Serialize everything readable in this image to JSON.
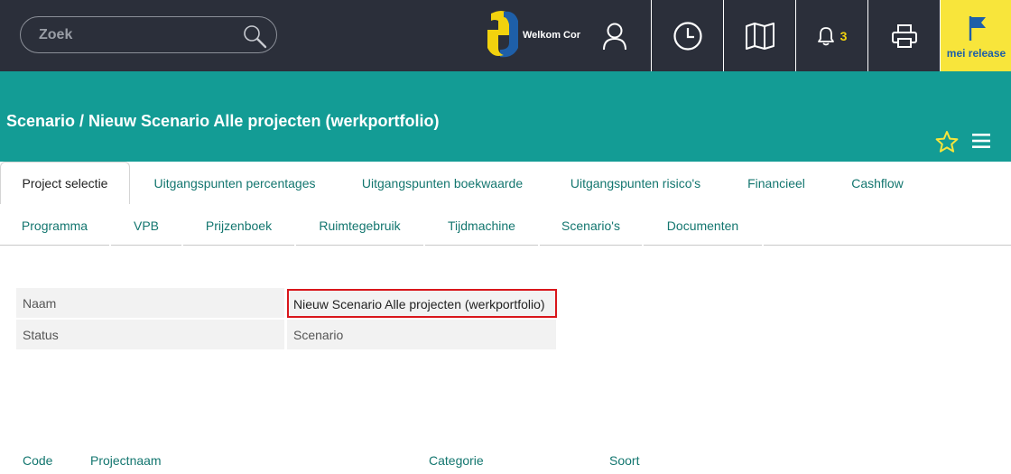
{
  "header": {
    "search_placeholder": "Zoek",
    "welcome_text": "Welkom Cor",
    "notification_count": "3",
    "release_label": "mei release",
    "colors": {
      "topbar": "#2b2f3a",
      "accent": "#139c95",
      "release": "#f8e53b",
      "badge": "#f2d20e"
    }
  },
  "page": {
    "title": "Scenario / Nieuw Scenario Alle projecten (werkportfolio)"
  },
  "tabs": [
    {
      "label": "Project selectie",
      "active": true
    },
    {
      "label": "Uitgangspunten percentages"
    },
    {
      "label": "Uitgangspunten boekwaarde"
    },
    {
      "label": "Uitgangspunten risico's"
    },
    {
      "label": "Financieel"
    },
    {
      "label": "Cashflow"
    },
    {
      "label": "Programma"
    },
    {
      "label": "VPB"
    },
    {
      "label": "Prijzenboek"
    },
    {
      "label": "Ruimtegebruik"
    },
    {
      "label": "Tijdmachine"
    },
    {
      "label": "Scenario's"
    },
    {
      "label": "Documenten"
    }
  ],
  "form": {
    "name_label": "Naam",
    "name_value": "Nieuw Scenario Alle projecten (werkportfolio)",
    "status_label": "Status",
    "status_value": "Scenario"
  },
  "table": {
    "columns": [
      "Code",
      "Projectnaam",
      "Categorie",
      "Soort"
    ]
  }
}
